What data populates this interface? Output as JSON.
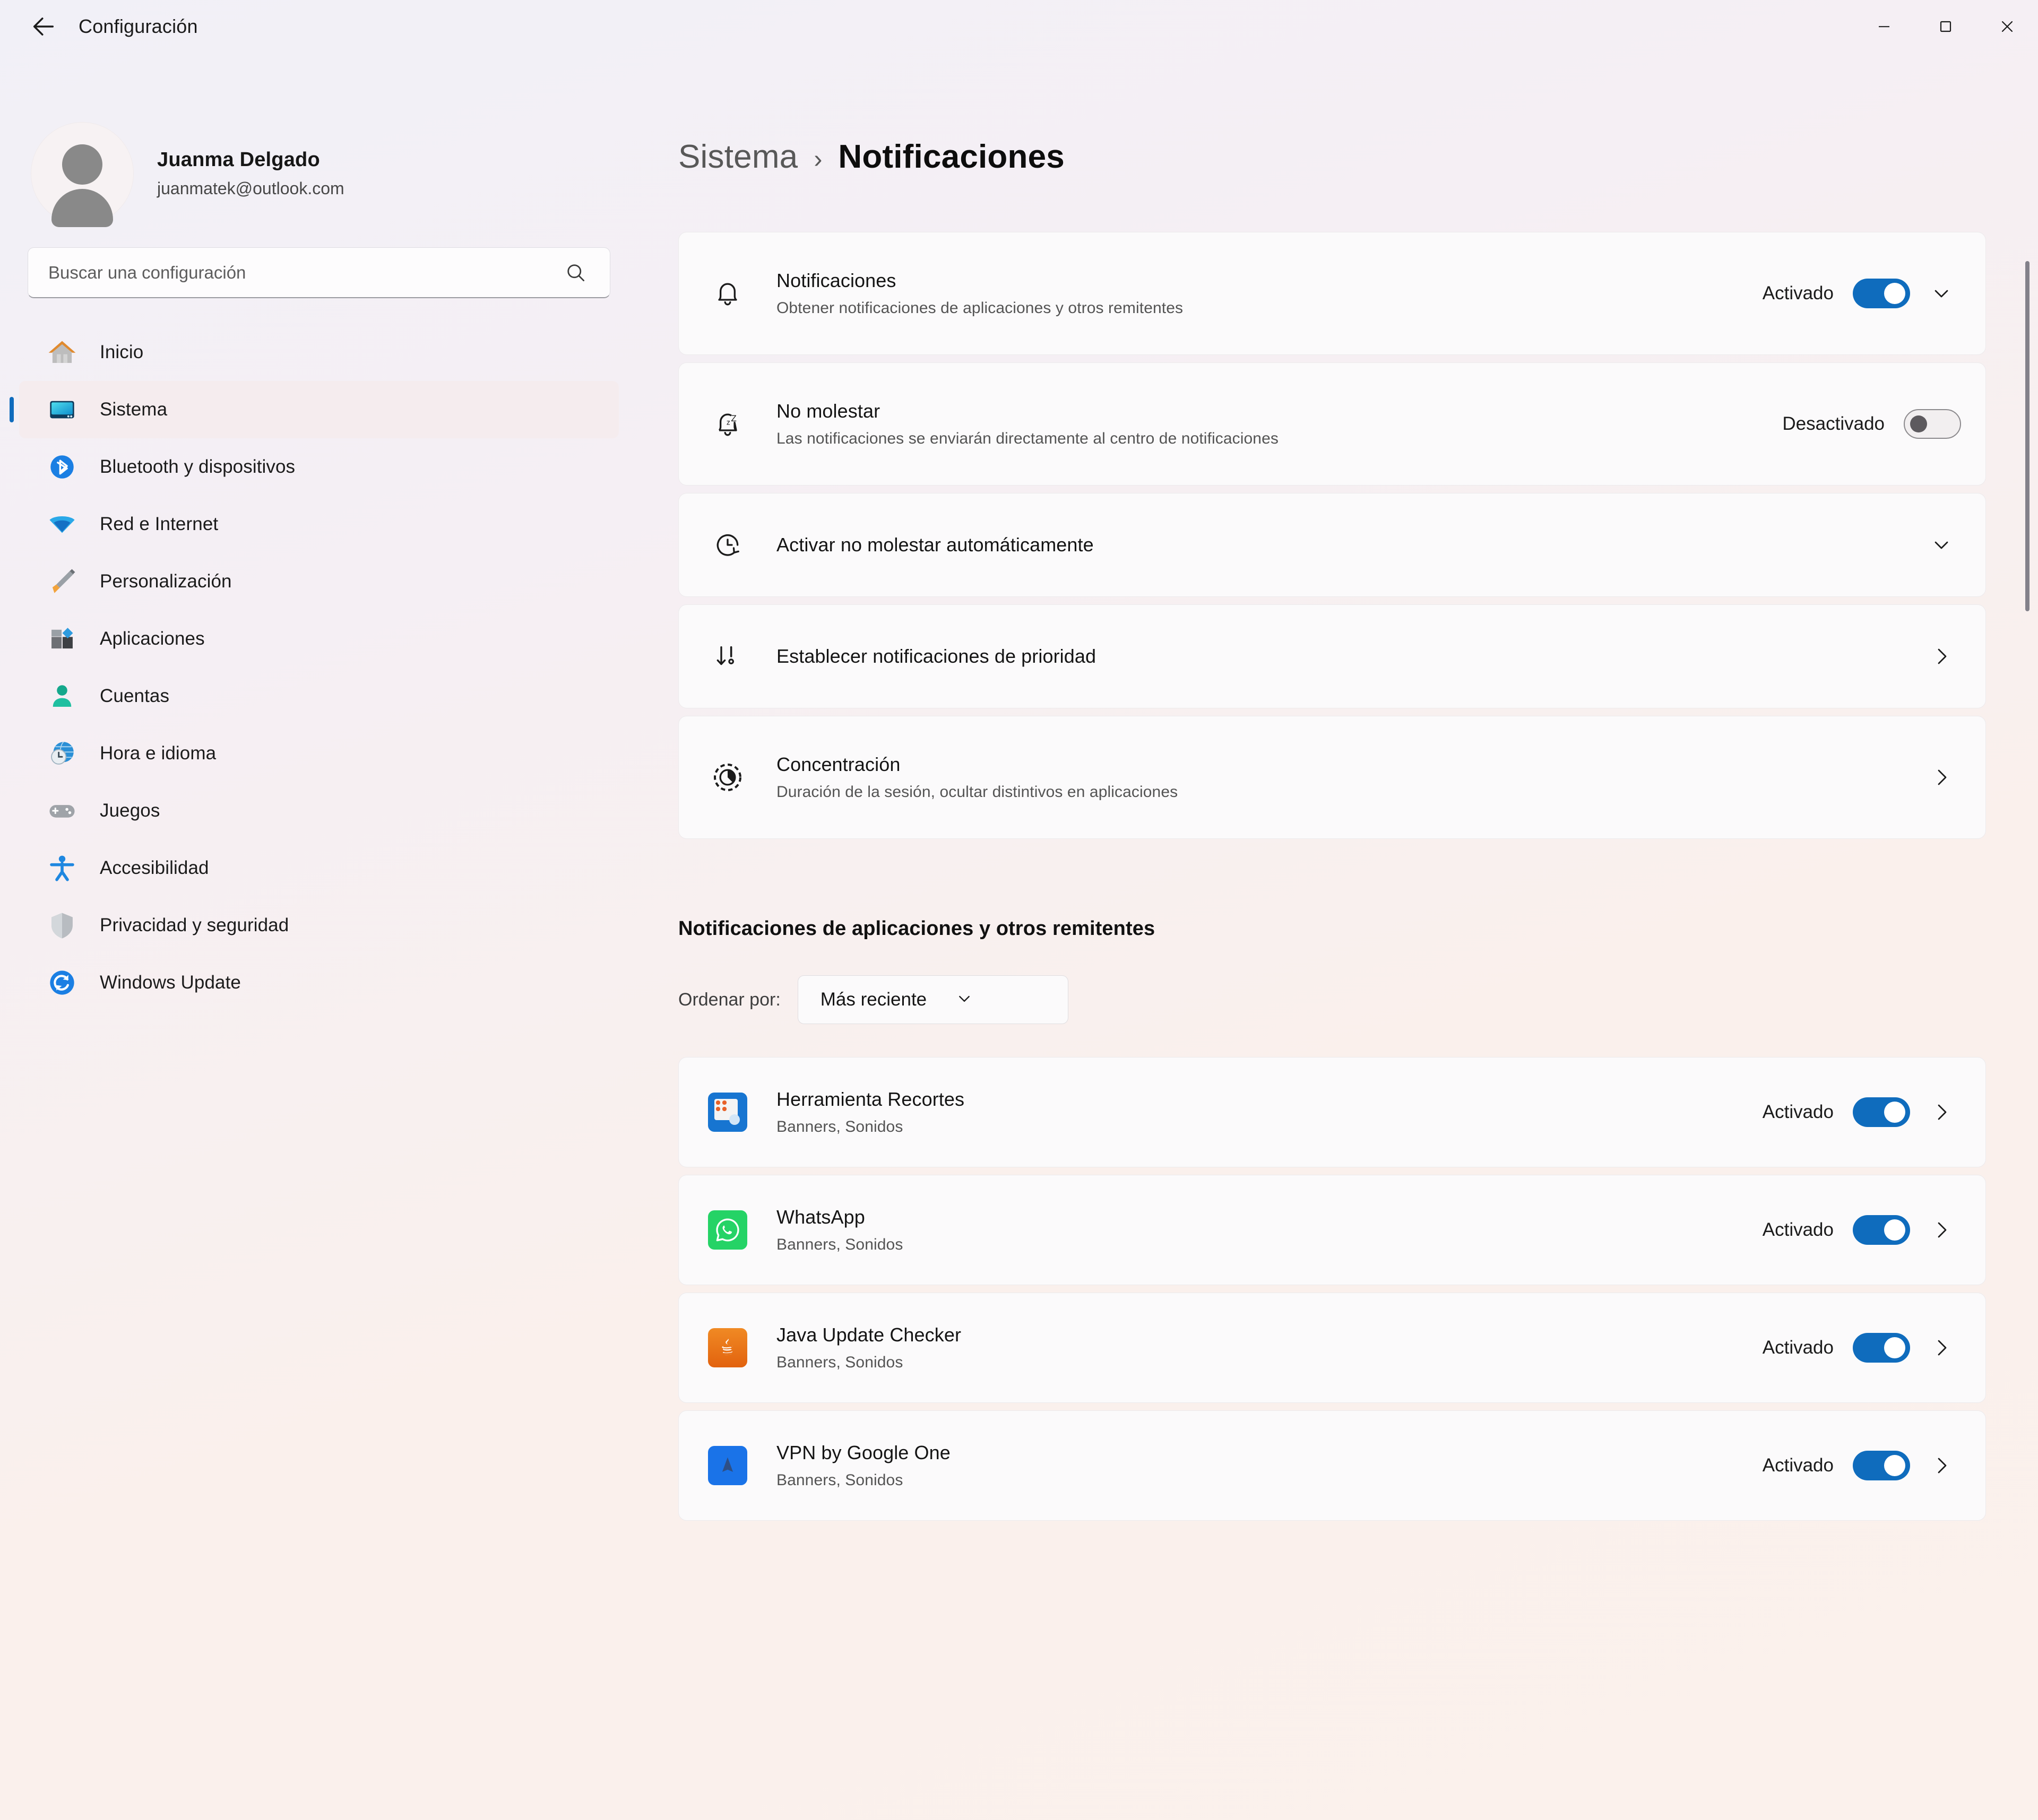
{
  "window": {
    "title": "Configuración",
    "back_icon": "back-arrow-icon",
    "minimize_label": "Minimizar",
    "maximize_label": "Maximizar",
    "close_label": "Cerrar"
  },
  "account": {
    "name": "Juanma Delgado",
    "email": "juanmatek@outlook.com"
  },
  "search": {
    "placeholder": "Buscar una configuración",
    "value": "",
    "icon": "search-icon"
  },
  "sidebar": {
    "items": [
      {
        "label": "Inicio",
        "icon": "home-icon",
        "selected": false
      },
      {
        "label": "Sistema",
        "icon": "system-display-icon",
        "selected": true
      },
      {
        "label": "Bluetooth y dispositivos",
        "icon": "bluetooth-icon",
        "selected": false
      },
      {
        "label": "Red e Internet",
        "icon": "wifi-icon",
        "selected": false
      },
      {
        "label": "Personalización",
        "icon": "paintbrush-icon",
        "selected": false
      },
      {
        "label": "Aplicaciones",
        "icon": "apps-icon",
        "selected": false
      },
      {
        "label": "Cuentas",
        "icon": "person-icon",
        "selected": false
      },
      {
        "label": "Hora e idioma",
        "icon": "clock-globe-icon",
        "selected": false
      },
      {
        "label": "Juegos",
        "icon": "gamepad-icon",
        "selected": false
      },
      {
        "label": "Accesibilidad",
        "icon": "accessibility-icon",
        "selected": false
      },
      {
        "label": "Privacidad y seguridad",
        "icon": "shield-icon",
        "selected": false
      },
      {
        "label": "Windows Update",
        "icon": "update-sync-icon",
        "selected": false
      }
    ]
  },
  "breadcrumb": {
    "parent": "Sistema",
    "separator": "›",
    "current": "Notificaciones"
  },
  "settings_cards": [
    {
      "id": "notificaciones",
      "icon": "bell-icon",
      "title": "Notificaciones",
      "subtitle": "Obtener notificaciones de aplicaciones y otros remitentes",
      "state_text": "Activado",
      "toggle": "on",
      "chevron": "chevron-down-icon"
    },
    {
      "id": "no-molestar",
      "icon": "bell-sleep-icon",
      "title": "No molestar",
      "subtitle": "Las notificaciones se enviarán directamente al centro de notificaciones",
      "state_text": "Desactivado",
      "toggle": "off",
      "chevron": ""
    },
    {
      "id": "activar-auto",
      "icon": "clock-refresh-icon",
      "title": "Activar no molestar automáticamente",
      "subtitle": "",
      "state_text": "",
      "toggle": "",
      "chevron": "chevron-down-icon"
    },
    {
      "id": "prioridad",
      "icon": "priority-arrow-icon",
      "title": "Establecer notificaciones de prioridad",
      "subtitle": "",
      "state_text": "",
      "toggle": "",
      "chevron": "chevron-right-icon"
    },
    {
      "id": "concentracion",
      "icon": "focus-icon",
      "title": "Concentración",
      "subtitle": "Duración de la sesión, ocultar distintivos en aplicaciones",
      "state_text": "",
      "toggle": "",
      "chevron": "chevron-right-icon"
    }
  ],
  "apps_section": {
    "heading": "Notificaciones de aplicaciones y otros remitentes",
    "sort_label": "Ordenar por:",
    "sort_value": "Más reciente",
    "sort_chevron": "chevron-down-icon",
    "apps": [
      {
        "name": "Herramienta Recortes",
        "detail": "Banners, Sonidos",
        "state_text": "Activado",
        "toggle": "on",
        "icon": "snipping-tool-icon",
        "chevron": "chevron-right-icon"
      },
      {
        "name": "WhatsApp",
        "detail": "Banners, Sonidos",
        "state_text": "Activado",
        "toggle": "on",
        "icon": "whatsapp-icon",
        "chevron": "chevron-right-icon"
      },
      {
        "name": "Java Update Checker",
        "detail": "Banners, Sonidos",
        "state_text": "Activado",
        "toggle": "on",
        "icon": "java-icon",
        "chevron": "chevron-right-icon"
      },
      {
        "name": "VPN by Google One",
        "detail": "Banners, Sonidos",
        "state_text": "Activado",
        "toggle": "on",
        "icon": "vpn-google-one-icon",
        "chevron": "chevron-right-icon"
      }
    ]
  },
  "colors": {
    "accent": "#0f6cbd",
    "card_bg": "#fbfafb",
    "selected_nav_bg": "#f5ecee"
  }
}
